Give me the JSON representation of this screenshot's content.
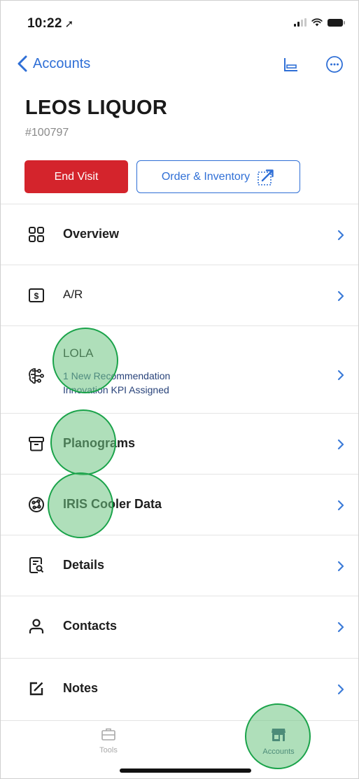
{
  "status_bar": {
    "time": "10:22",
    "location_glyph": "➚"
  },
  "nav": {
    "back_label": "Accounts"
  },
  "account": {
    "name": "LEOS LIQUOR",
    "number": "#100797"
  },
  "actions": {
    "end_visit": "End Visit",
    "order_inventory": "Order & Inventory"
  },
  "menu": [
    {
      "label": "Overview",
      "icon": "grid-icon"
    },
    {
      "label": "A/R",
      "icon": "dollar-box-icon"
    },
    {
      "label": "LOLA",
      "icon": "brain-icon",
      "sub": [
        "1 New Recommendation",
        "Innovation KPI Assigned"
      ]
    },
    {
      "label": "Planograms",
      "icon": "archive-icon"
    },
    {
      "label": "IRIS Cooler Data",
      "icon": "globe-network-icon"
    },
    {
      "label": "Details",
      "icon": "document-search-icon"
    },
    {
      "label": "Contacts",
      "icon": "person-icon"
    },
    {
      "label": "Notes",
      "icon": "edit-note-icon"
    }
  ],
  "tabbar": {
    "tools": "Tools",
    "accounts": "Accounts"
  },
  "colors": {
    "accent": "#2f6fd6",
    "danger": "#d4242c",
    "touch": "#1aa34a",
    "active_tab": "#25456e"
  }
}
